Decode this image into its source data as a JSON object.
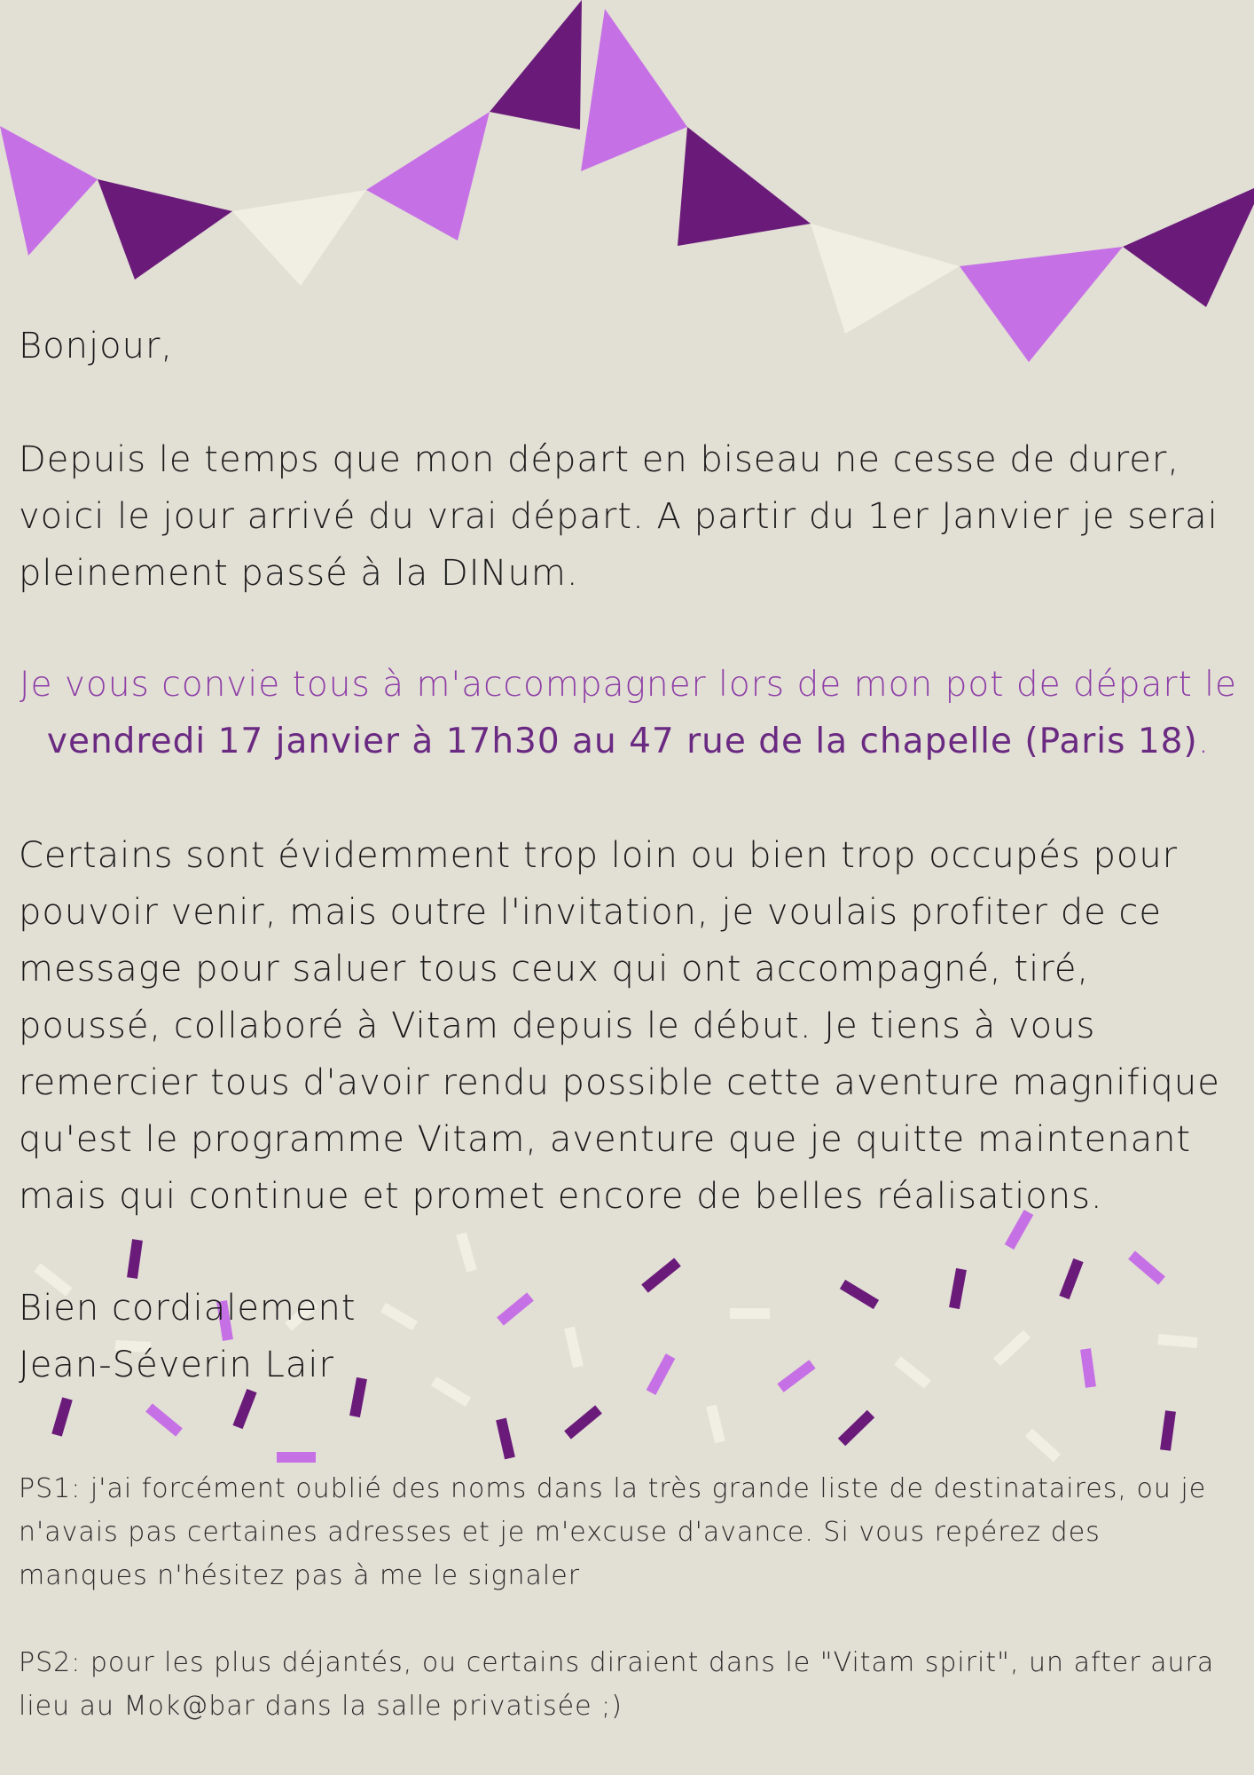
{
  "colors": {
    "background": "#e2dfd5",
    "dark_purple": "#6a1b7a",
    "light_purple": "#c670e6",
    "cream": "#f1efe4",
    "text": "#1b1b1b",
    "invite_text": "#8e3fa6"
  },
  "decor": {
    "banner": "bunting-flags-garland",
    "confetti": "confetti-decoration"
  },
  "letter": {
    "greeting": "Bonjour,",
    "paragraph1": "Depuis le temps que mon départ en biseau ne cesse de durer, voici le jour arrivé du vrai départ. A partir du 1er Janvier je serai pleinement passé à la DINum.",
    "invite_intro": "Je vous convie tous à m'accompagner lors de mon pot de départ le",
    "invite_details": "vendredi 17 janvier à 17h30 au 47 rue de la chapelle (Paris 18)",
    "invite_end": ".",
    "paragraph2": "Certains sont évidemment trop loin ou bien trop occupés pour pouvoir venir, mais outre l'invitation, je voulais profiter de ce message pour saluer tous ceux qui ont accompagné, tiré, poussé, collaboré à Vitam depuis le début. Je tiens à vous remercier tous d'avoir rendu possible cette aventure magnifique qu'est le programme Vitam, aventure que je quitte maintenant mais qui continue et promet encore de belles réalisations.",
    "closing": "Bien cordialement",
    "signature": "Jean-Séverin Lair",
    "ps1": "PS1: j'ai forcément oublié des noms dans la très grande liste de destinataires, ou je n'avais pas certaines adresses et je m'excuse d'avance. Si vous repérez des manques n'hésitez pas à me le signaler",
    "ps2": "PS2: pour les plus déjantés, ou certains diraient dans le \"Vitam spirit\", un after aura lieu au Mok@bar dans la salle privatisée ;)"
  }
}
